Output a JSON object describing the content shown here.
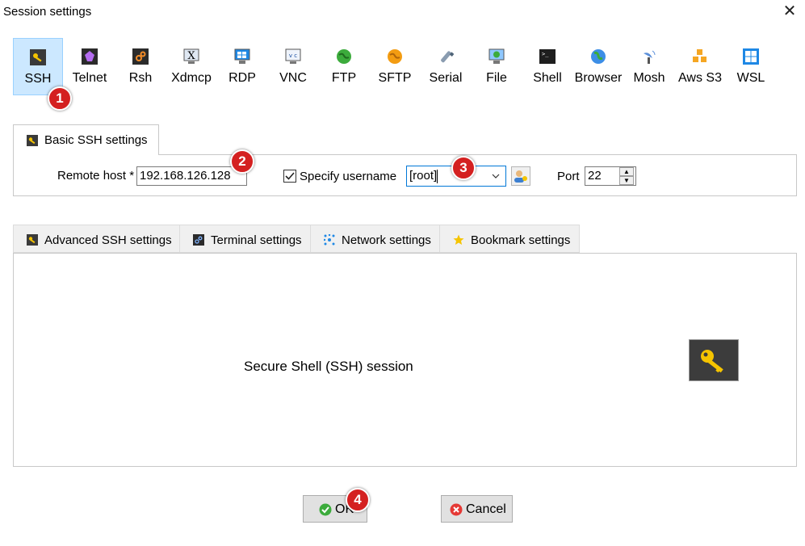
{
  "window": {
    "title": "Session settings",
    "close_glyph": "✕"
  },
  "protocols": [
    {
      "label": "SSH",
      "icon": "ssh-key-icon"
    },
    {
      "label": "Telnet",
      "icon": "telnet-icon"
    },
    {
      "label": "Rsh",
      "icon": "rsh-icon"
    },
    {
      "label": "Xdmcp",
      "icon": "xdmcp-icon"
    },
    {
      "label": "RDP",
      "icon": "rdp-icon"
    },
    {
      "label": "VNC",
      "icon": "vnc-icon"
    },
    {
      "label": "FTP",
      "icon": "ftp-globe-icon"
    },
    {
      "label": "SFTP",
      "icon": "sftp-globe-icon"
    },
    {
      "label": "Serial",
      "icon": "serial-plug-icon"
    },
    {
      "label": "File",
      "icon": "file-monitor-icon"
    },
    {
      "label": "Shell",
      "icon": "shell-terminal-icon"
    },
    {
      "label": "Browser",
      "icon": "browser-globe-icon"
    },
    {
      "label": "Mosh",
      "icon": "mosh-satellite-icon"
    },
    {
      "label": "Aws S3",
      "icon": "aws-s3-cubes-icon"
    },
    {
      "label": "WSL",
      "icon": "windows-logo-icon"
    }
  ],
  "selected_protocol": "SSH",
  "basic_tab": {
    "label": "Basic SSH settings"
  },
  "basic": {
    "remote_host_label": "Remote host *",
    "remote_host_value": "192.168.126.128",
    "specify_username_label": "Specify username",
    "specify_username_checked": true,
    "username_value": "[root]",
    "port_label": "Port",
    "port_value": "22"
  },
  "lower_tabs": [
    {
      "label": "Advanced SSH settings",
      "icon": "key-icon"
    },
    {
      "label": "Terminal settings",
      "icon": "terminal-icon"
    },
    {
      "label": "Network settings",
      "icon": "network-icon"
    },
    {
      "label": "Bookmark settings",
      "icon": "star-icon"
    }
  ],
  "panel": {
    "description": "Secure Shell (SSH) session"
  },
  "buttons": {
    "ok": "OK",
    "cancel": "Cancel"
  },
  "badges": [
    "1",
    "2",
    "3",
    "4"
  ],
  "colors": {
    "selected_bg": "#cce8ff",
    "selected_border": "#99d1ff",
    "badge_red": "#d42020",
    "key_yellow": "#f5c400",
    "focus_blue": "#0078d7"
  }
}
